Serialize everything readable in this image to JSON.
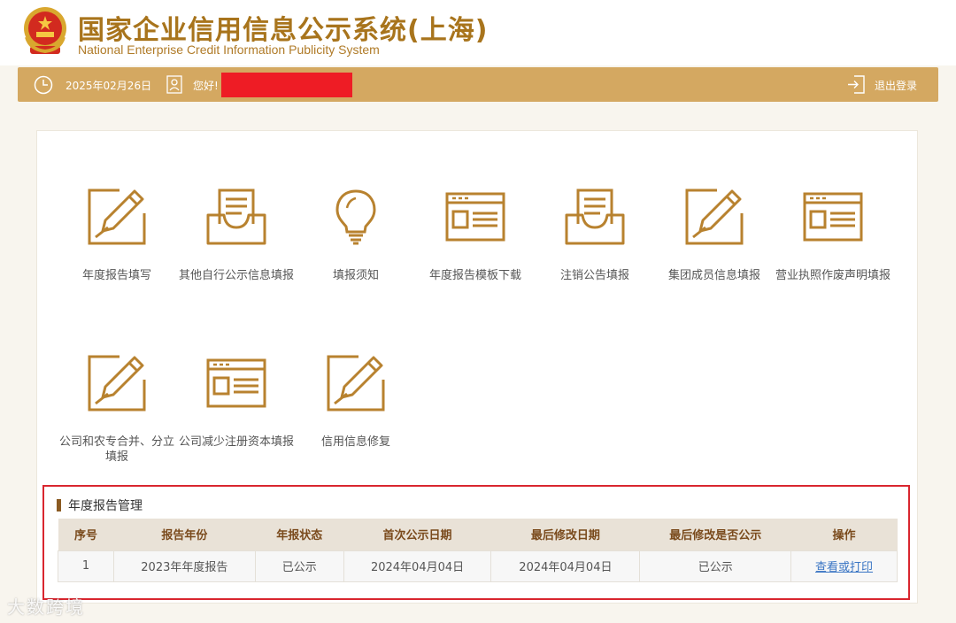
{
  "header": {
    "title": "国家企业信用信息公示系统(上海)",
    "subtitle": "National Enterprise Credit Information Publicity System",
    "emblem_icon": "national-emblem-icon"
  },
  "topbar": {
    "date": "2025年02月26日",
    "greeting": "您好!",
    "logout": "退出登录",
    "color": "#d4a861"
  },
  "tiles": [
    {
      "label": "年度报告填写",
      "icon": "edit-icon"
    },
    {
      "label": "其他自行公示信息填报",
      "icon": "tray-icon"
    },
    {
      "label": "填报须知",
      "icon": "lightbulb-icon"
    },
    {
      "label": "年度报告模板下载",
      "icon": "template-icon"
    },
    {
      "label": "注销公告填报",
      "icon": "tray-icon"
    },
    {
      "label": "集团成员信息填报",
      "icon": "edit-icon"
    },
    {
      "label": "营业执照作废声明填报",
      "icon": "template-icon"
    },
    {
      "label": "公司和农专合并、分立填报",
      "icon": "edit-icon"
    },
    {
      "label": "公司减少注册资本填报",
      "icon": "template-icon"
    },
    {
      "label": "信用信息修复",
      "icon": "edit-icon"
    }
  ],
  "annual_report": {
    "title": "年度报告管理",
    "columns": [
      "序号",
      "报告年份",
      "年报状态",
      "首次公示日期",
      "最后修改日期",
      "最后修改是否公示",
      "操作"
    ],
    "rows": [
      {
        "no": "1",
        "year": "2023年年度报告",
        "status": "已公示",
        "first_date": "2024年04月04日",
        "last_date": "2024年04月04日",
        "last_public": "已公示",
        "action": "查看或打印"
      }
    ]
  },
  "watermark": "大数跨境"
}
